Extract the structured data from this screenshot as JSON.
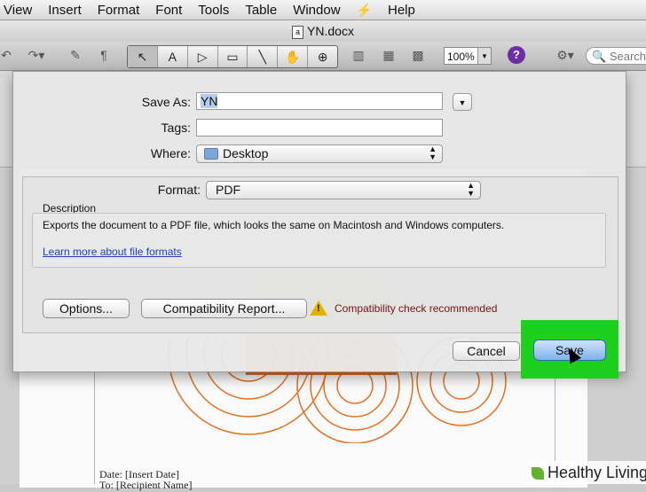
{
  "menubar": {
    "items": [
      "View",
      "Insert",
      "Format",
      "Font",
      "Tools",
      "Table",
      "Window",
      "",
      "Help"
    ]
  },
  "window": {
    "title": "YN.docx"
  },
  "toolbar": {
    "zoom": "100%",
    "help": "?",
    "search_placeholder": "Search in"
  },
  "dialog": {
    "save_as_label": "Save As:",
    "save_as_value": "YN",
    "tags_label": "Tags:",
    "tags_value": "",
    "where_label": "Where:",
    "where_value": "Desktop",
    "format_label": "Format:",
    "format_value": "PDF",
    "description_heading": "Description",
    "description_text": "Exports the document to a PDF file, which looks the same on Macintosh and Windows computers.",
    "learn_more_link": "Learn more about file formats",
    "options_button": "Options...",
    "compat_button": "Compatibility Report...",
    "compat_warning": "Compatibility check recommended",
    "cancel_button": "Cancel",
    "save_button": "Save"
  },
  "document": {
    "line1": "Date: [Insert Date]",
    "line2": "To: [Recipient Name]"
  },
  "watermark": "Healthy Living",
  "colors": {
    "highlight": "#1ed01e",
    "warning_text": "#7a1010",
    "link": "#1a3fb8",
    "orange": "#e07020"
  }
}
